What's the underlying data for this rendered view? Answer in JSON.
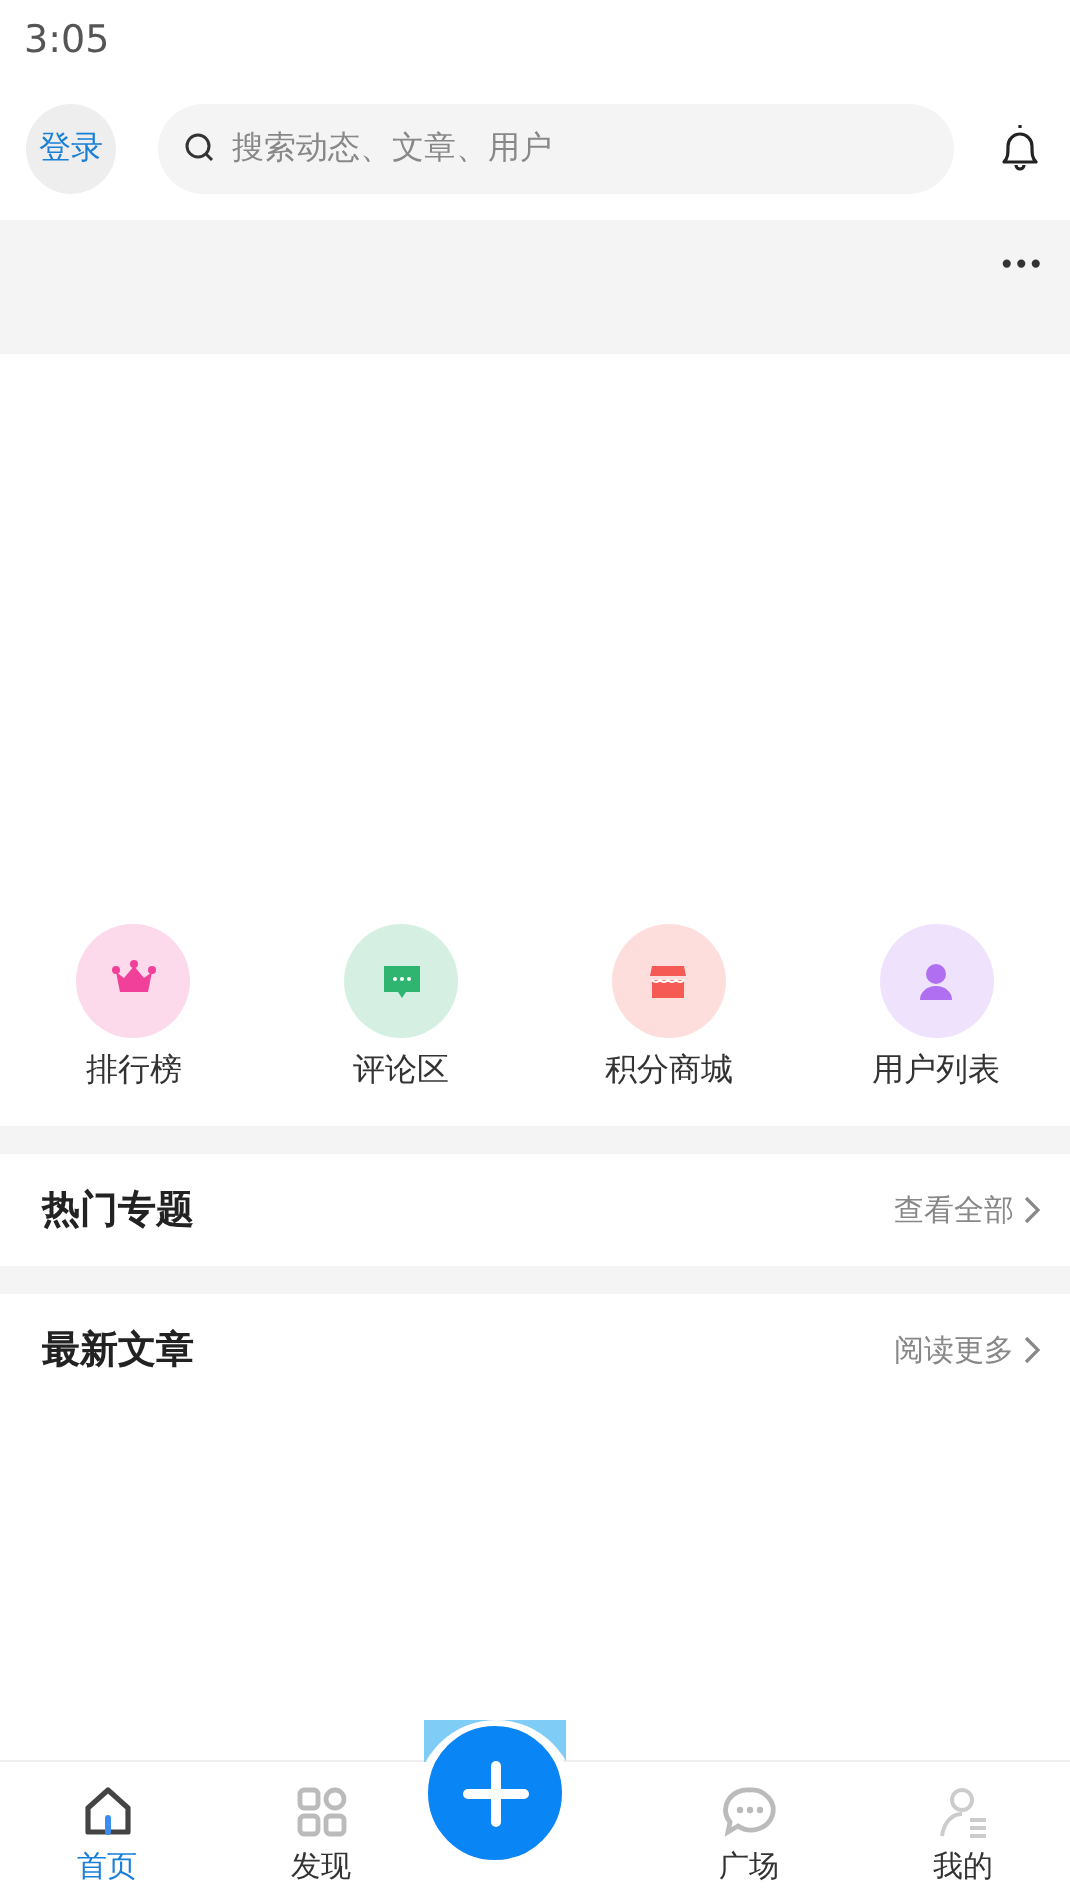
{
  "status_bar": {
    "time": "3:05"
  },
  "header": {
    "login": "登录",
    "search": {
      "placeholder": "搜索动态、文章、用户"
    }
  },
  "banner": {
    "menu": "•••"
  },
  "shortcuts": [
    {
      "label": "排行榜",
      "color": "#f0409a"
    },
    {
      "label": "评论区",
      "color": "#2fb56f"
    },
    {
      "label": "积分商城",
      "color": "#f55a55"
    },
    {
      "label": "用户列表",
      "color": "#b06ef0"
    }
  ],
  "sections": [
    {
      "title": "热门专题",
      "link": "查看全部"
    },
    {
      "title": "最新文章",
      "link": "阅读更多"
    }
  ],
  "tab_bar": [
    {
      "kind": "tab",
      "label": "首页",
      "selected": true
    },
    {
      "kind": "tab",
      "label": "发现",
      "selected": false
    },
    {
      "kind": "add"
    },
    {
      "kind": "tab",
      "label": "广场",
      "selected": false
    },
    {
      "kind": "tab",
      "label": "我的",
      "selected": false
    }
  ]
}
